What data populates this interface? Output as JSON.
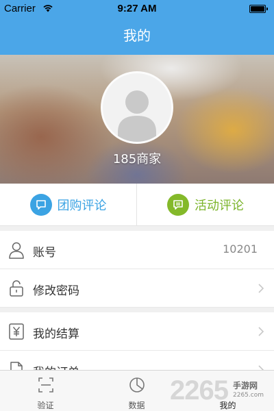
{
  "status_bar": {
    "carrier": "Carrier",
    "time": "9:27 AM"
  },
  "nav": {
    "title": "我的"
  },
  "profile": {
    "name": "185商家"
  },
  "reviews": {
    "group_buy_label": "团购评论",
    "activity_label": "活动评论",
    "group_buy_color": "#3ba3e3",
    "activity_color": "#7bb42a"
  },
  "list": {
    "account_label": "账号",
    "account_value": "10201",
    "change_password_label": "修改密码",
    "settlement_label": "我的结算",
    "orders_label": "我的订单"
  },
  "tabs": {
    "verify_label": "验证",
    "data_label": "数据",
    "mine_label": "我的"
  },
  "watermark": {
    "logo_text": "2265",
    "cn_text": "手游网",
    "url_text": "2265.com"
  },
  "colors": {
    "nav_blue": "#4ba6e8"
  }
}
